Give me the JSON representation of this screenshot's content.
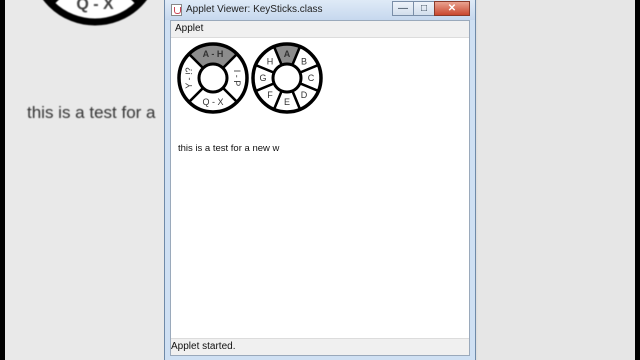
{
  "background": {
    "big_text": "this is a test for a",
    "big_wheel_label": "Q - X"
  },
  "window": {
    "title": "Applet Viewer: KeySticks.class",
    "minimize_icon": "minimize-icon",
    "maximize_icon": "maximize-icon",
    "close_icon": "close-icon"
  },
  "menubar": {
    "applet_menu": "Applet"
  },
  "wheel_left": {
    "segments": [
      "A - H",
      "I - P",
      "Q - X",
      "Y - !?"
    ],
    "selected": "A - H"
  },
  "wheel_right": {
    "segments": [
      "A",
      "B",
      "C",
      "D",
      "E",
      "F",
      "G",
      "H"
    ],
    "selected": "A"
  },
  "applet": {
    "text": "this is a test for a new w"
  },
  "status": {
    "text": "Applet started."
  },
  "colors": {
    "selected_segment": "#8c8c8c",
    "close_button": "#c9472f",
    "titlebar": "#cfe0f3"
  }
}
